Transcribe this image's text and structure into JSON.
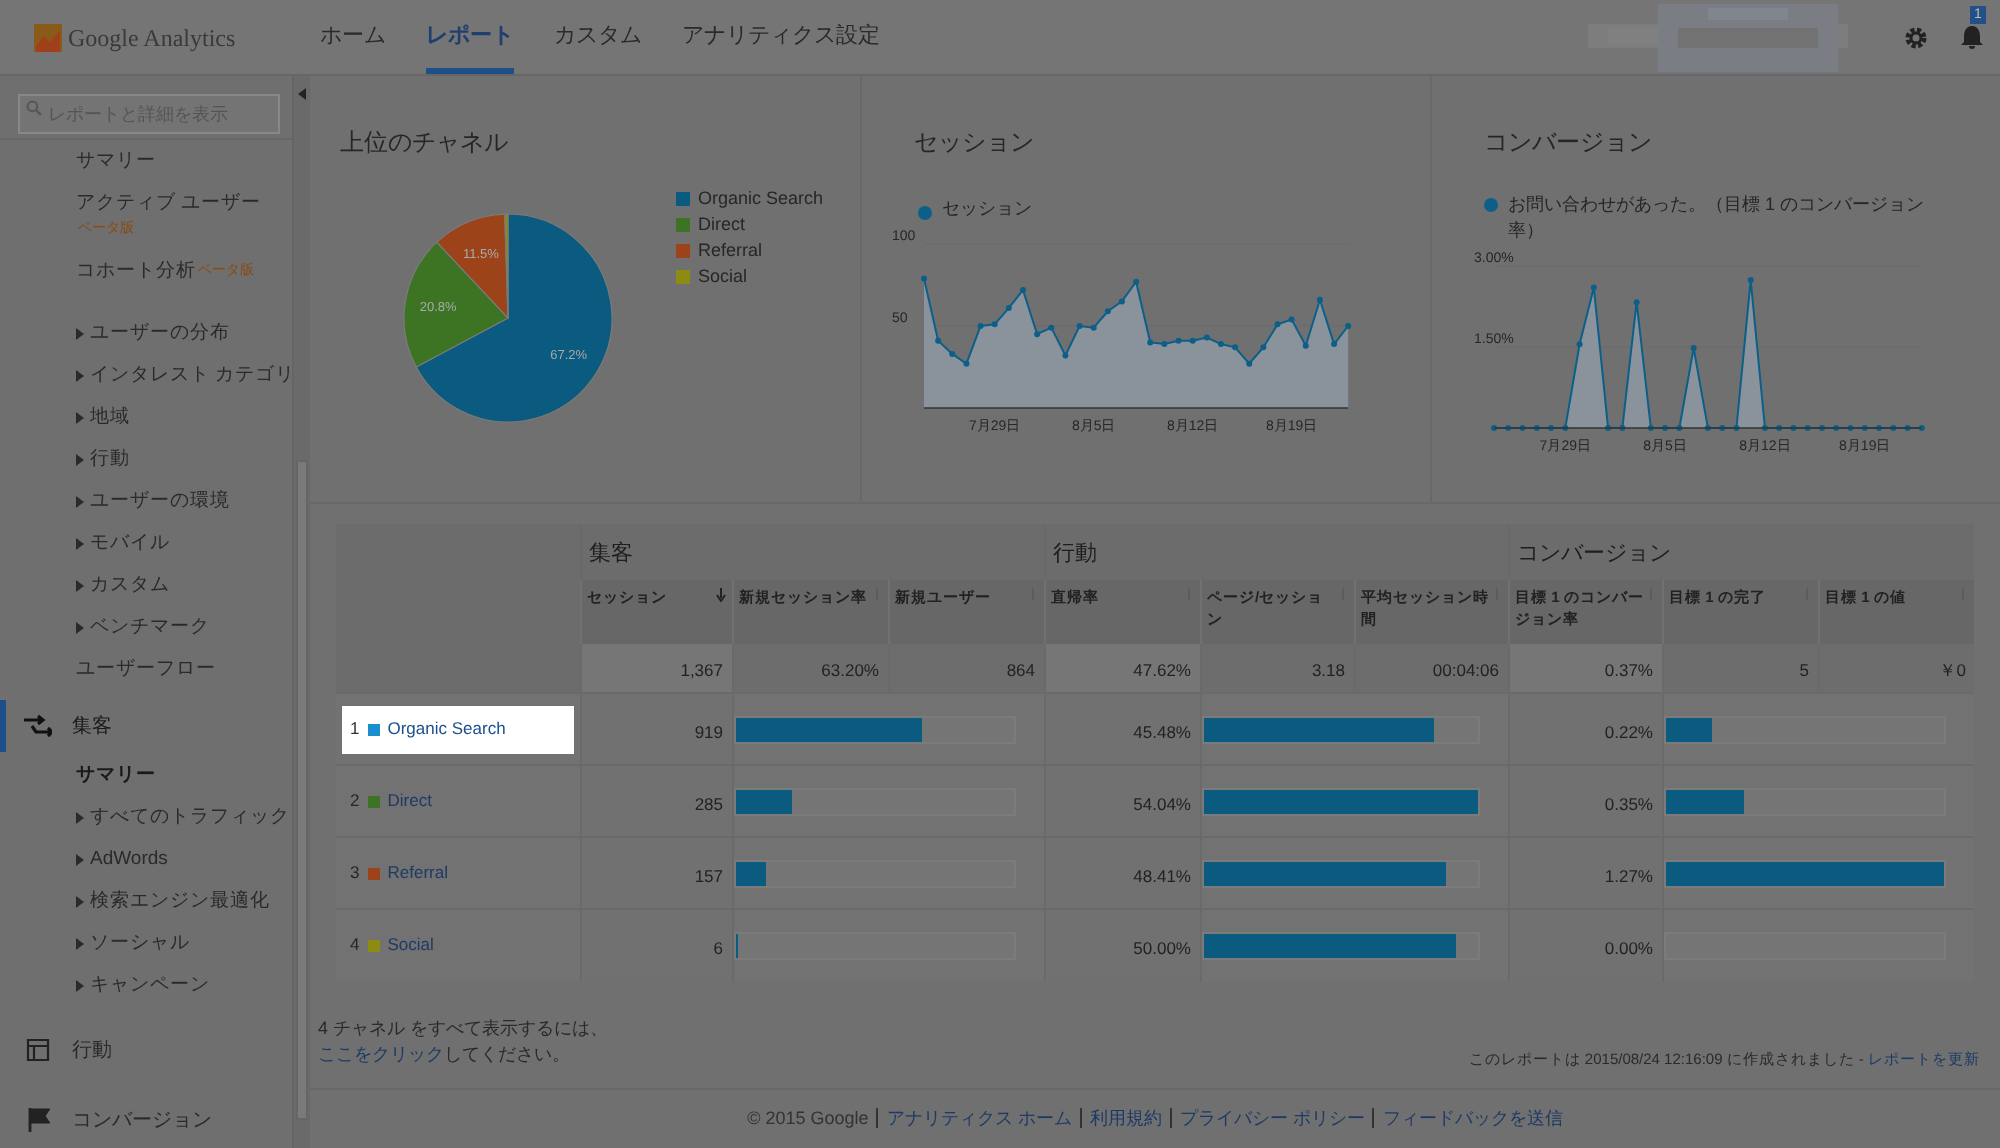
{
  "header": {
    "logo": "Google Analytics",
    "tabs": [
      {
        "label": "ホーム",
        "selected": false
      },
      {
        "label": "レポート",
        "selected": true
      },
      {
        "label": "カスタム",
        "selected": false
      },
      {
        "label": "アナリティクス設定",
        "selected": false
      }
    ],
    "notification_count": "1"
  },
  "sidebar": {
    "search_placeholder": "レポートと詳細を表示",
    "scrolled_items": [
      {
        "label": "サマリー",
        "expandable": false,
        "selected": false
      },
      {
        "label": "アクティブ ユーザー",
        "badge": "ベータ版",
        "expandable": false,
        "selected": false
      },
      {
        "label": "コホート分析",
        "badge": "ベータ版",
        "expandable": false,
        "selected": false
      },
      {
        "label": "ユーザーの分布",
        "expandable": true,
        "selected": false
      },
      {
        "label": "インタレスト カテゴリ",
        "expandable": true,
        "selected": false
      },
      {
        "label": "地域",
        "expandable": true,
        "selected": false
      },
      {
        "label": "行動",
        "expandable": true,
        "selected": false
      },
      {
        "label": "ユーザーの環境",
        "expandable": true,
        "selected": false
      },
      {
        "label": "モバイル",
        "expandable": true,
        "selected": false
      },
      {
        "label": "カスタム",
        "expandable": true,
        "selected": false
      },
      {
        "label": "ベンチマーク",
        "expandable": true,
        "selected": false
      },
      {
        "label": "ユーザーフロー",
        "expandable": false,
        "selected": false
      }
    ],
    "sections": [
      {
        "label": "集客",
        "selected": true,
        "children": [
          {
            "label": "サマリー",
            "expandable": false,
            "selected": true
          },
          {
            "label": "すべてのトラフィック",
            "expandable": true,
            "selected": false
          },
          {
            "label": "AdWords",
            "expandable": true,
            "selected": false
          },
          {
            "label": "検索エンジン最適化",
            "expandable": true,
            "selected": false
          },
          {
            "label": "ソーシャル",
            "expandable": true,
            "selected": false
          },
          {
            "label": "キャンペーン",
            "expandable": true,
            "selected": false
          }
        ]
      },
      {
        "label": "行動",
        "selected": false
      },
      {
        "label": "コンバージョン",
        "selected": false
      }
    ]
  },
  "top_channels": {
    "title": "上位のチャネル",
    "chart_data": {
      "type": "pie",
      "categories": [
        "Organic Search",
        "Direct",
        "Referral",
        "Social"
      ],
      "colors": [
        "#0b5a80",
        "#3c7424",
        "#9c4319",
        "#8c8c12"
      ],
      "series": [
        {
          "values": [
            67.2,
            20.8,
            11.5,
            0.5
          ]
        }
      ],
      "value_labels": [
        "67.2%",
        "20.8%",
        "11.5%",
        null
      ]
    }
  },
  "sessions_card": {
    "title": "セッション",
    "chart_data": {
      "type": "area",
      "ylim": [
        0,
        100
      ],
      "categories": [
        null,
        null,
        null,
        null,
        null,
        "7月29日",
        null,
        null,
        null,
        null,
        null,
        null,
        "8月5日",
        null,
        null,
        null,
        null,
        null,
        null,
        "8月12日",
        null,
        null,
        null,
        null,
        null,
        null,
        "8月19日",
        null,
        null,
        null,
        null
      ],
      "yticks": [
        {
          "value": 50,
          "label": "50"
        },
        {
          "value": 100,
          "label": "100"
        }
      ],
      "series": [
        {
          "name": "セッション",
          "color": "#0b5f88",
          "values": [
            79,
            41,
            33,
            27,
            50,
            51,
            61,
            72,
            45,
            49,
            32,
            50,
            49,
            59,
            65,
            77,
            40,
            39,
            41,
            41,
            43,
            39,
            37,
            27,
            37,
            51,
            54,
            38,
            66,
            39,
            50
          ]
        }
      ]
    }
  },
  "conversions_card": {
    "title": "コンバージョン",
    "chart_data": {
      "type": "area",
      "ylim": [
        0,
        3
      ],
      "categories": [
        null,
        null,
        null,
        null,
        null,
        "7月29日",
        null,
        null,
        null,
        null,
        null,
        null,
        "8月5日",
        null,
        null,
        null,
        null,
        null,
        null,
        "8月12日",
        null,
        null,
        null,
        null,
        null,
        null,
        "8月19日",
        null,
        null,
        null,
        null
      ],
      "yticks": [
        {
          "value": 1.5,
          "label": "1.50%"
        },
        {
          "value": 3,
          "label": "3.00%"
        }
      ],
      "series": [
        {
          "name": "お問い合わせがあった。（目標 1 のコンバージョン率）",
          "color": "#0b5f88",
          "values": [
            0,
            0,
            0,
            0,
            0,
            0,
            1.55,
            2.6,
            0,
            0,
            2.33,
            0,
            0,
            0,
            1.48,
            0,
            0,
            0,
            2.74,
            0,
            0,
            0,
            0,
            0,
            0,
            0,
            0,
            0,
            0,
            0,
            0
          ]
        }
      ]
    }
  },
  "table": {
    "groups": [
      {
        "label": "集客"
      },
      {
        "label": "行動"
      },
      {
        "label": "コンバージョン"
      }
    ],
    "columns": [
      {
        "label": "セッション",
        "sorted": true
      },
      {
        "label": "新規セッション率",
        "sorted": false
      },
      {
        "label": "新規ユーザー",
        "sorted": false
      },
      {
        "label": "直帰率",
        "sorted": false
      },
      {
        "label": "ページ/セッション",
        "sorted": false
      },
      {
        "label": "平均セッション時間",
        "sorted": false
      },
      {
        "label": "目標 1 のコンバージョン率",
        "sorted": false
      },
      {
        "label": "目標 1 の完了",
        "sorted": false
      },
      {
        "label": "目標 1 の値",
        "sorted": false
      }
    ],
    "totals": [
      "1,367",
      "63.20%",
      "864",
      "47.62%",
      "3.18",
      "00:04:06",
      "0.37%",
      "5",
      "￥0"
    ],
    "rows": [
      {
        "index": "1",
        "label": "Organic Search",
        "color": "#1a8fd0",
        "highlighted": true,
        "sessions": "919",
        "bounce_rate": "45.48%",
        "conversion_rate": "0.22%",
        "bars": [
          {
            "level": 0.672
          },
          {
            "level": 0.84
          },
          {
            "level": 0.17
          }
        ]
      },
      {
        "index": "2",
        "label": "Direct",
        "color": "#3c7424",
        "highlighted": false,
        "sessions": "285",
        "bounce_rate": "54.04%",
        "conversion_rate": "0.35%",
        "bars": [
          {
            "level": 0.208
          },
          {
            "level": 1
          },
          {
            "level": 0.28
          }
        ]
      },
      {
        "index": "3",
        "label": "Referral",
        "color": "#9c4319",
        "highlighted": false,
        "sessions": "157",
        "bounce_rate": "48.41%",
        "conversion_rate": "1.27%",
        "bars": [
          {
            "level": 0.115
          },
          {
            "level": 0.89
          },
          {
            "level": 1
          }
        ]
      },
      {
        "index": "4",
        "label": "Social",
        "color": "#8c8c12",
        "highlighted": false,
        "sessions": "6",
        "bounce_rate": "50.00%",
        "conversion_rate": "0.00%",
        "bars": [
          {
            "level": 0.006
          },
          {
            "level": 0.92
          },
          {
            "level": 0
          }
        ]
      }
    ]
  },
  "note": {
    "text": "4 チャネル をすべて表示するには、",
    "link": "ここをクリック",
    "after": "してください。"
  },
  "report_time": {
    "text": "このレポートは 2015/08/24 12:16:09 に作成されました - ",
    "link": "レポートを更新"
  },
  "footer": {
    "copyright": "© 2015 Google",
    "links": [
      "アナリティクス ホーム",
      "利用規約",
      "プライバシー ポリシー",
      "フィードバックを送信"
    ]
  }
}
